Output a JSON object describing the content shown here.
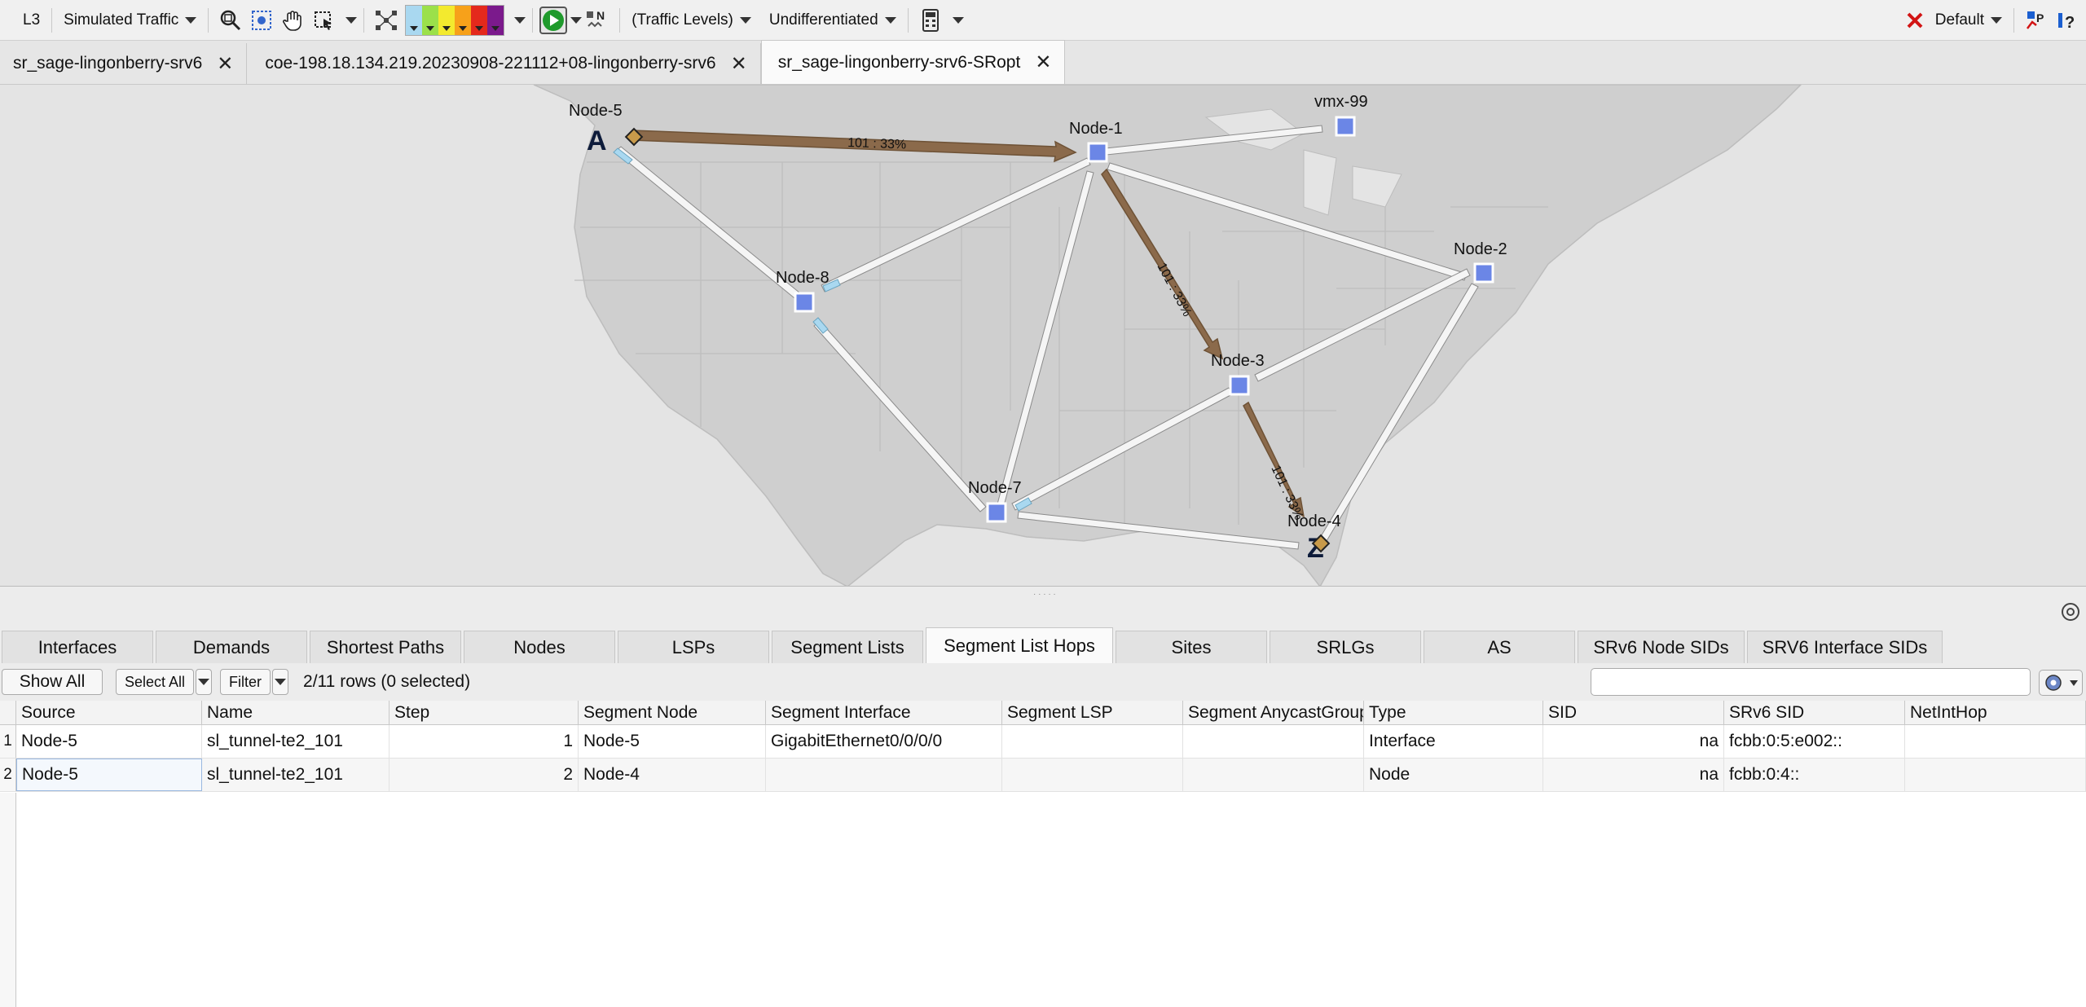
{
  "toolbar": {
    "layer": "L3",
    "traffic_mode": "Simulated Traffic",
    "traffic_levels": "(Traffic Levels)",
    "differentiation": "Undifferentiated",
    "profile": "Default",
    "icons": [
      "zoom-icon",
      "fit-icon",
      "pan-hand-icon",
      "select-region-icon",
      "layout-icon",
      "play-icon",
      "node-label-icon",
      "calculator-icon",
      "error-x-icon",
      "plot-icon",
      "help-icon"
    ],
    "swatch_colors": [
      "#a9d8f0",
      "#9be04a",
      "#f3ea2e",
      "#f7a11a",
      "#e4291c",
      "#7b1a8c"
    ]
  },
  "doc_tabs": [
    {
      "label": "sr_sage-lingonberry-srv6",
      "active": false
    },
    {
      "label": "coe-198.18.134.219.20230908-221112+08-lingonberry-srv6",
      "active": false
    },
    {
      "label": "sr_sage-lingonberry-srv6-SRopt",
      "active": true
    }
  ],
  "map": {
    "nodes": [
      "Node-5",
      "vmx-99",
      "Node-1",
      "Node-2",
      "Node-8",
      "Node-3",
      "Node-7",
      "Node-4"
    ],
    "flow_labels": [
      "101 : 33%",
      "101 : 33%",
      "101 : 33%"
    ],
    "source_marker": "A",
    "dest_marker": "Z",
    "colors": {
      "flow": "#8b6a4b",
      "node": "#6b86e6",
      "link": "#f4f4f4"
    }
  },
  "bottom_tabs": [
    "Interfaces",
    "Demands",
    "Shortest Paths",
    "Nodes",
    "LSPs",
    "Segment Lists",
    "Segment List Hops",
    "Sites",
    "SRLGs",
    "AS",
    "SRv6 Node SIDs",
    "SRV6 Interface SIDs"
  ],
  "active_bottom_tab": "Segment List Hops",
  "filterbar": {
    "show_all": "Show All",
    "select_all": "Select All",
    "filter": "Filter",
    "row_status": "2/11 rows (0 selected)",
    "search_placeholder": ""
  },
  "table": {
    "columns": [
      "Source",
      "Name",
      "Step",
      "Segment Node",
      "Segment Interface",
      "Segment LSP",
      "Segment AnycastGroup",
      "Type",
      "SID",
      "SRv6 SID",
      "NetIntHop"
    ],
    "rows": [
      {
        "n": "1",
        "cells": [
          "Node-5",
          "sl_tunnel-te2_101",
          "1",
          "Node-5",
          "GigabitEthernet0/0/0/0",
          "",
          "",
          "Interface",
          "na",
          "fcbb:0:5:e002::",
          ""
        ]
      },
      {
        "n": "2",
        "cells": [
          "Node-5",
          "sl_tunnel-te2_101",
          "2",
          "Node-4",
          "",
          "",
          "",
          "Node",
          "na",
          "fcbb:0:4::",
          ""
        ]
      }
    ]
  }
}
